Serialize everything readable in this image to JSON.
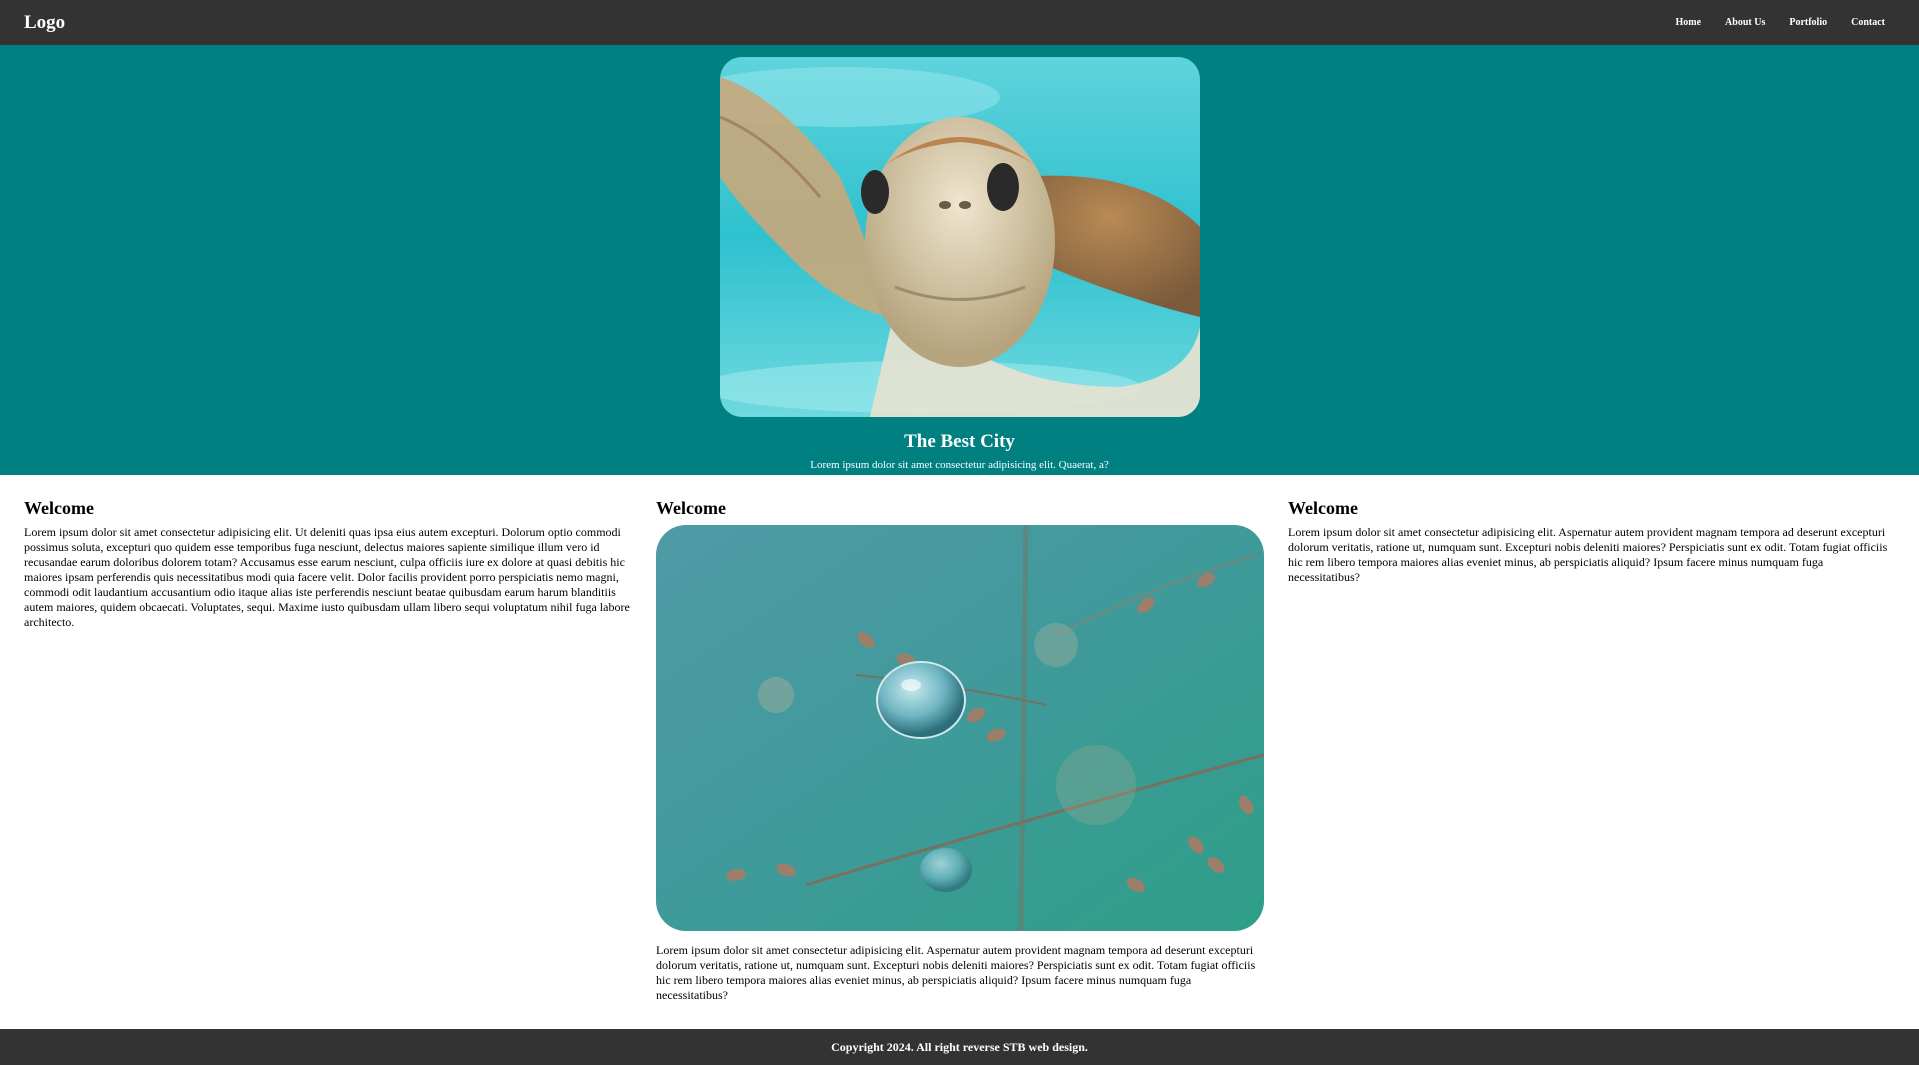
{
  "navbar": {
    "logo": "Logo",
    "links": [
      "Home",
      "About Us",
      "Portfolio",
      "Contact"
    ]
  },
  "hero": {
    "image_alt": "sea turtle",
    "title": "The Best City",
    "subtitle": "Lorem ipsum dolor sit amet consectetur adipisicing elit. Quaerat, a?"
  },
  "columns": [
    {
      "heading": "Welcome",
      "text": "Lorem ipsum dolor sit amet consectetur adipisicing elit. Ut deleniti quas ipsa eius autem excepturi. Dolorum optio commodi possimus soluta, excepturi quo quidem esse temporibus fuga nesciunt, delectus maiores sapiente similique illum vero id recusandae earum doloribus dolorem totam? Accusamus esse earum nesciunt, culpa officiis iure ex dolore at quasi debitis hic maiores ipsam perferendis quis necessitatibus modi quia facere velit. Dolor facilis provident porro perspiciatis nemo magni, commodi odit laudantium accusantium odio itaque alias iste perferendis nesciunt beatae quibusdam earum harum blanditiis autem maiores, quidem obcaecati. Voluptates, sequi. Maxime iusto quibusdam ullam libero sequi voluptatum nihil fuga labore architecto."
    },
    {
      "heading": "Welcome",
      "image_alt": "water droplet on grass",
      "text": "Lorem ipsum dolor sit amet consectetur adipisicing elit. Aspernatur autem provident magnam tempora ad deserunt excepturi dolorum veritatis, ratione ut, numquam sunt. Excepturi nobis deleniti maiores? Perspiciatis sunt ex odit. Totam fugiat officiis hic rem libero tempora maiores alias eveniet minus, ab perspiciatis aliquid? Ipsum facere minus numquam fuga necessitatibus?"
    },
    {
      "heading": "Welcome",
      "text": "Lorem ipsum dolor sit amet consectetur adipisicing elit. Aspernatur autem provident magnam tempora ad deserunt excepturi dolorum veritatis, ratione ut, numquam sunt. Excepturi nobis deleniti maiores? Perspiciatis sunt ex odit. Totam fugiat officiis hic rem libero tempora maiores alias eveniet minus, ab perspiciatis aliquid? Ipsum facere minus numquam fuga necessitatibus?"
    }
  ],
  "footer": {
    "text": "Copyright 2024. All right reverse STB web design."
  },
  "colors": {
    "navbar_bg": "#333333",
    "hero_bg": "#008080",
    "footer_bg": "#333333"
  }
}
